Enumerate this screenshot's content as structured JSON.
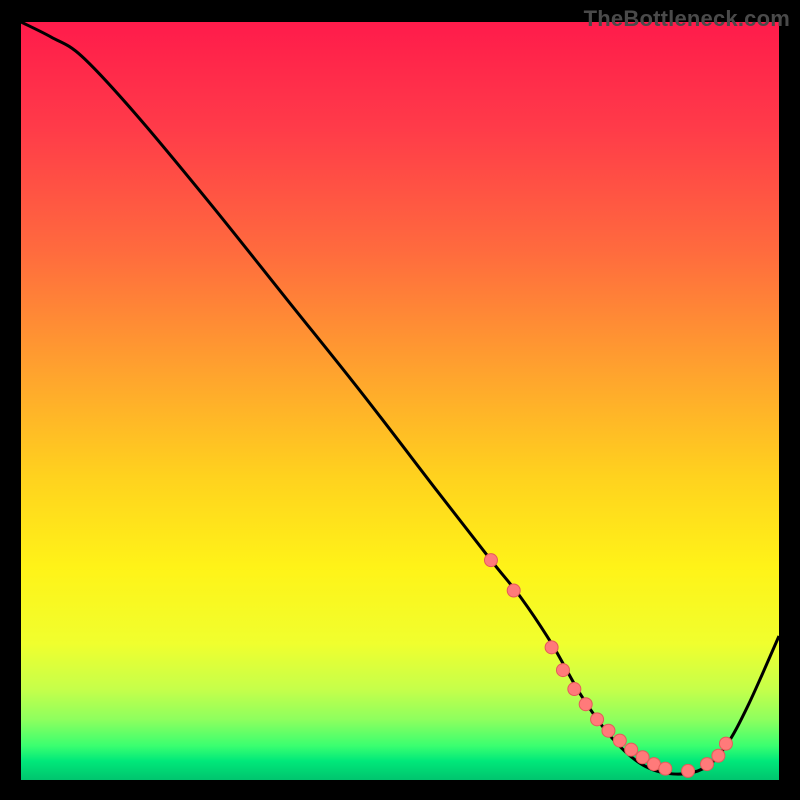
{
  "watermark": "TheBottleneck.com",
  "colors": {
    "page_bg": "#000000",
    "watermark": "#4a4a4a",
    "curve": "#000000",
    "dot_fill": "#ff7a7a",
    "dot_stroke": "#e55a5a",
    "gradient_stops": [
      {
        "offset": 0.0,
        "color": "#ff1b4b"
      },
      {
        "offset": 0.14,
        "color": "#ff3b49"
      },
      {
        "offset": 0.3,
        "color": "#ff6a3e"
      },
      {
        "offset": 0.46,
        "color": "#ffa22e"
      },
      {
        "offset": 0.6,
        "color": "#ffd21e"
      },
      {
        "offset": 0.72,
        "color": "#fff318"
      },
      {
        "offset": 0.82,
        "color": "#f0ff2e"
      },
      {
        "offset": 0.88,
        "color": "#c6ff4a"
      },
      {
        "offset": 0.92,
        "color": "#8eff5e"
      },
      {
        "offset": 0.955,
        "color": "#3aff70"
      },
      {
        "offset": 0.975,
        "color": "#00e87a"
      },
      {
        "offset": 1.0,
        "color": "#00c46e"
      }
    ]
  },
  "chart_data": {
    "type": "line",
    "title": "",
    "xlabel": "",
    "ylabel": "",
    "xlim": [
      0,
      100
    ],
    "ylim": [
      0,
      100
    ],
    "series": [
      {
        "name": "bottleneck-curve",
        "x": [
          0,
          4,
          8,
          15,
          25,
          35,
          45,
          55,
          62,
          66,
          70,
          74,
          78,
          82,
          86,
          90,
          93,
          96,
          100
        ],
        "y": [
          100,
          98,
          95.5,
          88,
          76,
          63.5,
          51,
          38,
          29,
          24,
          18,
          11,
          5.5,
          2,
          0.8,
          1.5,
          4.5,
          10,
          19
        ]
      }
    ],
    "marker_points": {
      "name": "curve-dots",
      "x": [
        62,
        65,
        70,
        71.5,
        73,
        74.5,
        76,
        77.5,
        79,
        80.5,
        82,
        83.5,
        85,
        88,
        90.5,
        92,
        93
      ],
      "y": [
        29,
        25,
        17.5,
        14.5,
        12,
        10,
        8,
        6.5,
        5.2,
        4,
        3,
        2.1,
        1.5,
        1.2,
        2.1,
        3.2,
        4.8
      ]
    }
  }
}
